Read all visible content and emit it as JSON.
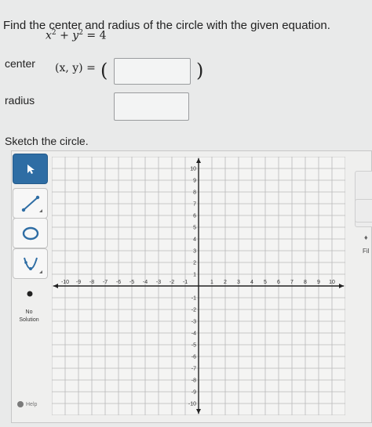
{
  "question": "Find the center and radius of the circle with the given equation.",
  "equation": {
    "x_base": "x",
    "x_exp": "2",
    "plus": " + ",
    "y_base": "y",
    "y_exp": "2",
    "rhs": " = 4"
  },
  "center": {
    "label": "center",
    "xy_text": "(x, y) =",
    "open_paren": "(",
    "close_paren": ")",
    "value": ""
  },
  "radius": {
    "label": "radius",
    "value": ""
  },
  "sketch_label": "Sketch the circle.",
  "tools": {
    "select": "arrow-pointer-icon",
    "line": "line-segment-icon",
    "circle": "circle-icon",
    "parabola": "parabola-icon",
    "point": "point-icon"
  },
  "no_solution": {
    "line1": "No",
    "line2": "Solution"
  },
  "help": "Help",
  "fill_label": "Fil",
  "graph": {
    "xlim": [
      -11,
      11
    ],
    "ylim": [
      -11,
      11
    ],
    "x_ticks": [
      "-10",
      "-9",
      "-8",
      "-7",
      "-6",
      "-5",
      "-4",
      "-3",
      "-2",
      "-1",
      "1",
      "2",
      "3",
      "4",
      "5",
      "6",
      "7",
      "8",
      "9",
      "10"
    ],
    "y_ticks": [
      "-10",
      "-9",
      "-8",
      "-7",
      "-6",
      "-5",
      "-4",
      "-3",
      "-2",
      "-1",
      "1",
      "2",
      "3",
      "4",
      "5",
      "6",
      "7",
      "8",
      "9",
      "10"
    ],
    "grid": true
  },
  "colors": {
    "accent": "#2e6da4",
    "grid": "#b9b9b9",
    "axis": "#222222"
  }
}
